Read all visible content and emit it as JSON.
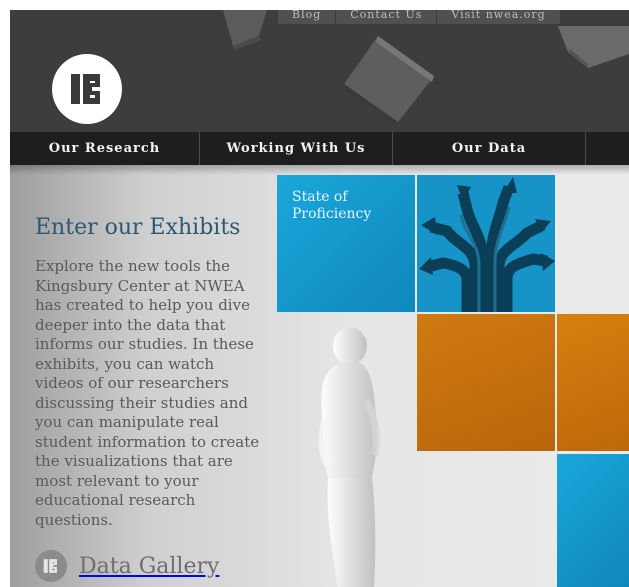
{
  "top_nav": {
    "items": [
      {
        "label": "Blog"
      },
      {
        "label": "Contact Us"
      },
      {
        "label": "Visit nwea.org"
      }
    ]
  },
  "main_nav": {
    "items": [
      {
        "label": "Our Research"
      },
      {
        "label": "Working With Us"
      },
      {
        "label": "Our Data"
      },
      {
        "label": ""
      }
    ]
  },
  "exhibits": {
    "title": "Enter our Exhibits",
    "body": "Explore the new tools the Kingsbury Center at NWEA has created to help you dive deeper into the data that informs our studies.  In these exhibits, you can watch videos of our researchers discussing their studies and you can manipulate real student information to create the visualizations that are most relevant to your educational research questions."
  },
  "tiles": {
    "state_of_proficiency": "State of Proficiency"
  },
  "gallery": {
    "label": "Data Gallery",
    "icon": "logo-icon"
  },
  "colors": {
    "header_bg": "#3d3d3d",
    "nav_bg": "#1e1e1e",
    "accent_blue": "#1694c8",
    "accent_orange": "#c8700d",
    "headline": "#2a5a72"
  }
}
